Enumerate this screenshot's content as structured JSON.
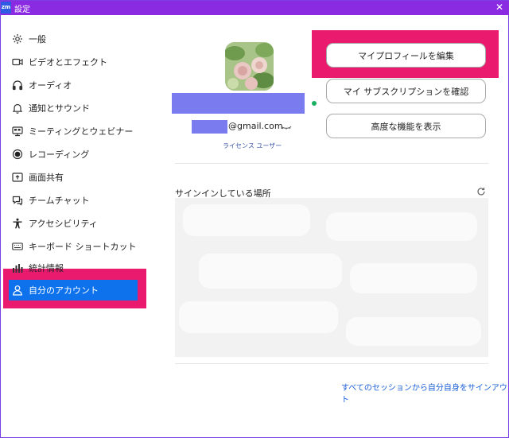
{
  "window": {
    "badge": "zm",
    "title": "設定",
    "close": "✕"
  },
  "sidebar": {
    "items": [
      {
        "label": "一般",
        "icon": "gear-icon"
      },
      {
        "label": "ビデオとエフェクト",
        "icon": "video-camera-icon"
      },
      {
        "label": "オーディオ",
        "icon": "headphones-icon"
      },
      {
        "label": "通知とサウンド",
        "icon": "bell-icon"
      },
      {
        "label": "ミーティングとウェビナー",
        "icon": "monitor-icon"
      },
      {
        "label": "レコーディング",
        "icon": "record-icon"
      },
      {
        "label": "画面共有",
        "icon": "share-screen-icon"
      },
      {
        "label": "チームチャット",
        "icon": "chat-icon"
      },
      {
        "label": "アクセシビリティ",
        "icon": "accessibility-icon"
      },
      {
        "label": "キーボード ショートカット",
        "icon": "keyboard-icon"
      },
      {
        "label": "統計情報",
        "icon": "statistics-icon"
      },
      {
        "label": "自分のアカウント",
        "icon": "user-icon",
        "active": true
      }
    ]
  },
  "profile": {
    "email_suffix": "@gmail.com",
    "license": "ライセンス ユーザー",
    "status_color": "#1bb061"
  },
  "buttons": {
    "edit_profile": "マイプロフィールを編集",
    "check_subscription": "マイ サブスクリプションを確認",
    "advanced_features": "高度な機能を表示"
  },
  "signin": {
    "title": "サインインしている場所",
    "signout_all": "すべてのセッションから自分自身をサインアウト"
  },
  "colors": {
    "titlebar": "#8a2be2",
    "highlight": "#ea1b6f",
    "active_nav": "#0e72ed",
    "redaction": "#7b7bf0",
    "link": "#1a5fd6"
  }
}
